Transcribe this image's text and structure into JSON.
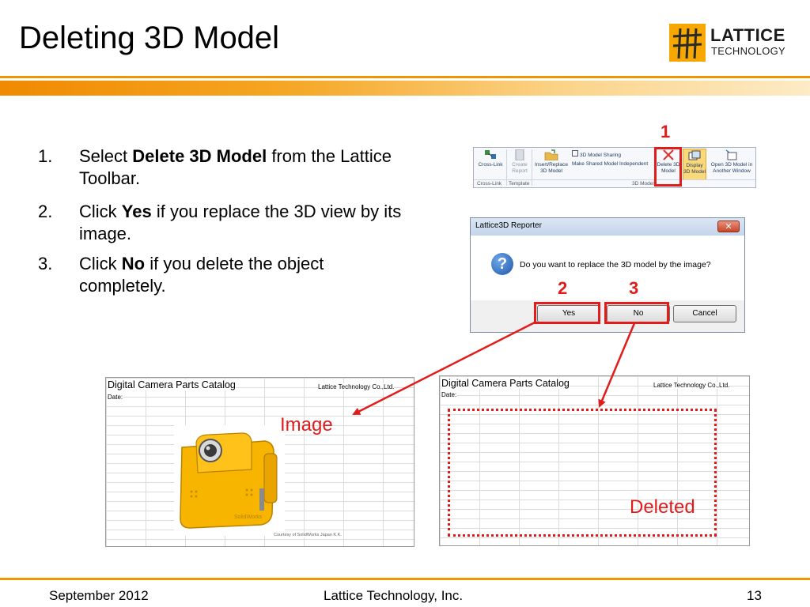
{
  "slide": {
    "title": "Deleting 3D Model",
    "logo": {
      "line1": "LATTICE",
      "line2": "TECHNOLOGY"
    },
    "colors": {
      "accent": "#f29400",
      "highlight": "#e21b1b"
    }
  },
  "steps": [
    {
      "num": "1.",
      "pre": "Select ",
      "bold": "Delete 3D Model",
      "post": " from the Lattice Toolbar."
    },
    {
      "num": "2.",
      "pre": "Click ",
      "bold": "Yes",
      "post": " if you replace the 3D view by its image."
    },
    {
      "num": "3.",
      "pre": "Click ",
      "bold": "No",
      "post": " if you delete the object completely."
    }
  ],
  "toolbar": {
    "items": [
      {
        "label1": "Cross-Link",
        "label2": "",
        "icon": "cross-link-icon"
      },
      {
        "label1": "Create",
        "label2": "Report",
        "icon": "create-report-icon"
      },
      {
        "label1": "Insert/Replace",
        "label2": "3D Model",
        "icon": "insert-replace-icon"
      },
      {
        "label1": "Delete 3D",
        "label2": "Model",
        "icon": "delete-x-icon"
      },
      {
        "label1": "Display",
        "label2": "3D Model",
        "icon": "display-3d-icon"
      },
      {
        "label1": "Open 3D Model in",
        "label2": "Another Window",
        "icon": "open-window-icon"
      }
    ],
    "sharing_label": "3D Model Sharing",
    "independent_label": "Make Shared Model Independent",
    "groups": [
      "Cross-Link",
      "Template",
      "3D Model"
    ]
  },
  "callouts": {
    "one": "1",
    "two": "2",
    "three": "3"
  },
  "dialog": {
    "title": "Lattice3D Reporter",
    "close": "✕",
    "message": "Do you want to replace the 3D model by the image?",
    "yes": "Yes",
    "no": "No",
    "cancel": "Cancel"
  },
  "sheets": {
    "title": "Digital Camera Parts Catalog",
    "company": "Lattice Technology Co.,Ltd.",
    "date": "Date:",
    "courtesy": "Courtesy of SolidWorks Japan K.K.",
    "camera_brand": "SolidWorks"
  },
  "labels": {
    "image": "Image",
    "deleted": "Deleted"
  },
  "footer": {
    "date": "September 2012",
    "company": "Lattice Technology, Inc.",
    "page": "13"
  }
}
